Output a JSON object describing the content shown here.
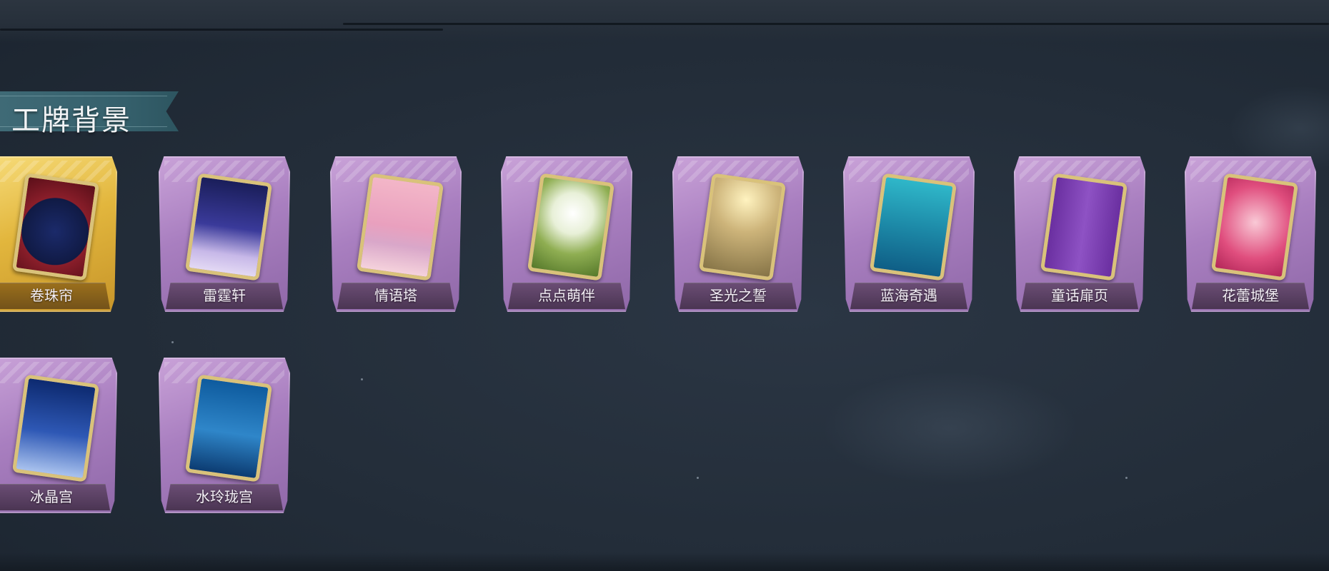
{
  "section": {
    "title": "工牌背景"
  },
  "cards": [
    {
      "label": "卷珠帘",
      "selected": true,
      "art": "curtain-art"
    },
    {
      "label": "雷霆轩",
      "selected": false,
      "art": "thunder-castle-art"
    },
    {
      "label": "情语塔",
      "selected": false,
      "art": "rose-tower-art"
    },
    {
      "label": "点点萌伴",
      "selected": false,
      "art": "meadow-art"
    },
    {
      "label": "圣光之誓",
      "selected": false,
      "art": "holy-light-art"
    },
    {
      "label": "蓝海奇遇",
      "selected": false,
      "art": "ocean-art"
    },
    {
      "label": "童话扉页",
      "selected": false,
      "art": "fairytale-curtain-art"
    },
    {
      "label": "花蕾城堡",
      "selected": false,
      "art": "pink-castle-art"
    },
    {
      "label": "冰晶宫",
      "selected": false,
      "art": "ice-palace-art"
    },
    {
      "label": "水玲珑宫",
      "selected": false,
      "art": "water-palace-art"
    }
  ]
}
